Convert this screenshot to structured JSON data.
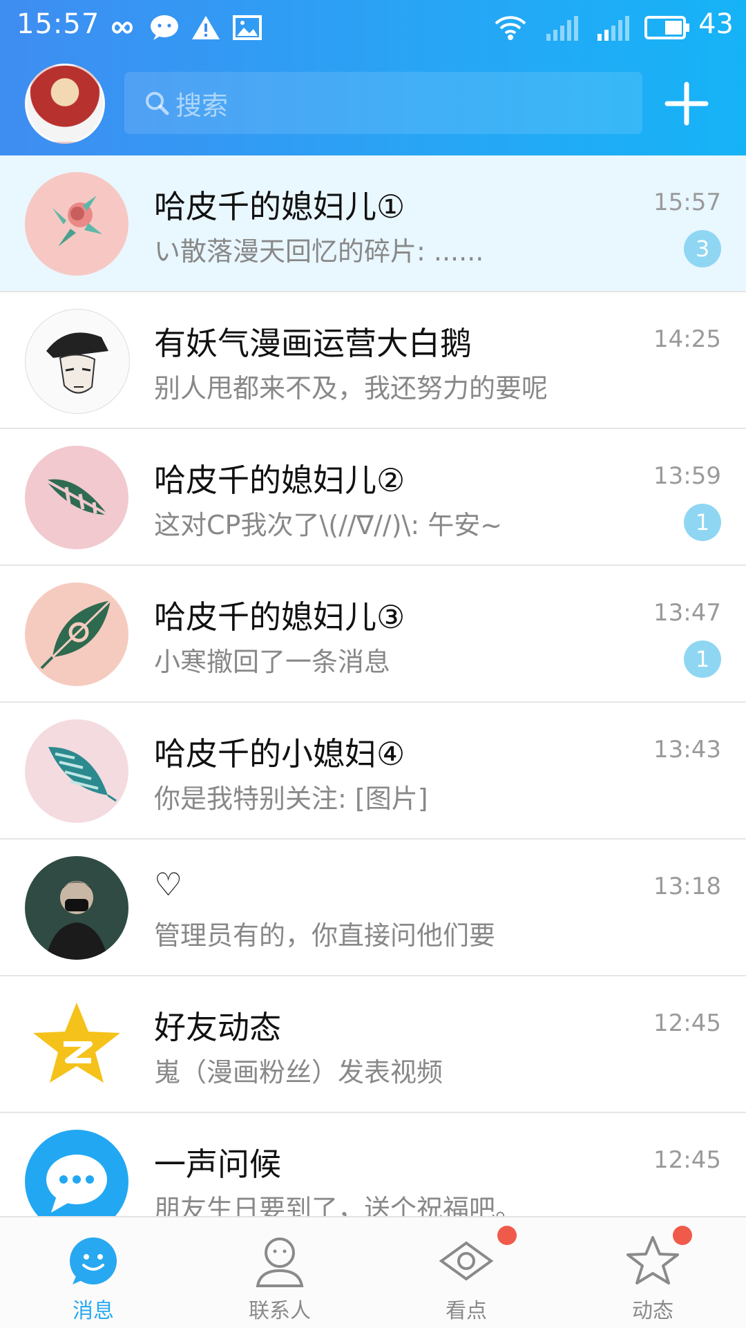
{
  "status_bar": {
    "time": "15:57",
    "battery": "43"
  },
  "search": {
    "placeholder": "搜索"
  },
  "conversations": [
    {
      "name": "哈皮千的媳妇儿①",
      "preview": "い散落漫天回忆的碎片: ......",
      "time": "15:57",
      "badge": "3",
      "pinned": true
    },
    {
      "name": "有妖气漫画运营大白鹅",
      "preview": "别人甩都来不及，我还努力的要呢",
      "time": "14:25",
      "badge": ""
    },
    {
      "name": "哈皮千的媳妇儿②",
      "preview": "这对CP我次了\\(//∇//)\\: 午安~",
      "time": "13:59",
      "badge": "1"
    },
    {
      "name": "哈皮千的媳妇儿③",
      "preview": "小寒撤回了一条消息",
      "time": "13:47",
      "badge": "1"
    },
    {
      "name": "哈皮千的小媳妇④",
      "preview": "你是我特别关注: [图片]",
      "time": "13:43",
      "badge": ""
    },
    {
      "name": "♡",
      "preview": "管理员有的，你直接问他们要",
      "time": "13:18",
      "badge": ""
    },
    {
      "name": "好友动态",
      "preview": "嵬（漫画粉丝）发表视频",
      "time": "12:45",
      "badge": ""
    },
    {
      "name": "一声问候",
      "preview": "朋友生日要到了，送个祝福吧。",
      "time": "12:45",
      "badge": ""
    }
  ],
  "tabs": [
    {
      "label": "消息",
      "icon": "message-face-icon",
      "active": true
    },
    {
      "label": "联系人",
      "icon": "contacts-person-icon",
      "active": false
    },
    {
      "label": "看点",
      "icon": "eye-icon",
      "active": false
    },
    {
      "label": "动态",
      "icon": "star-icon",
      "active": false
    }
  ],
  "colors": {
    "accent": "#28a8f0",
    "header_start": "#3f8df2",
    "header_end": "#16b3f7",
    "badge": "#8fd6f3",
    "red_dot": "#f05a4a"
  }
}
